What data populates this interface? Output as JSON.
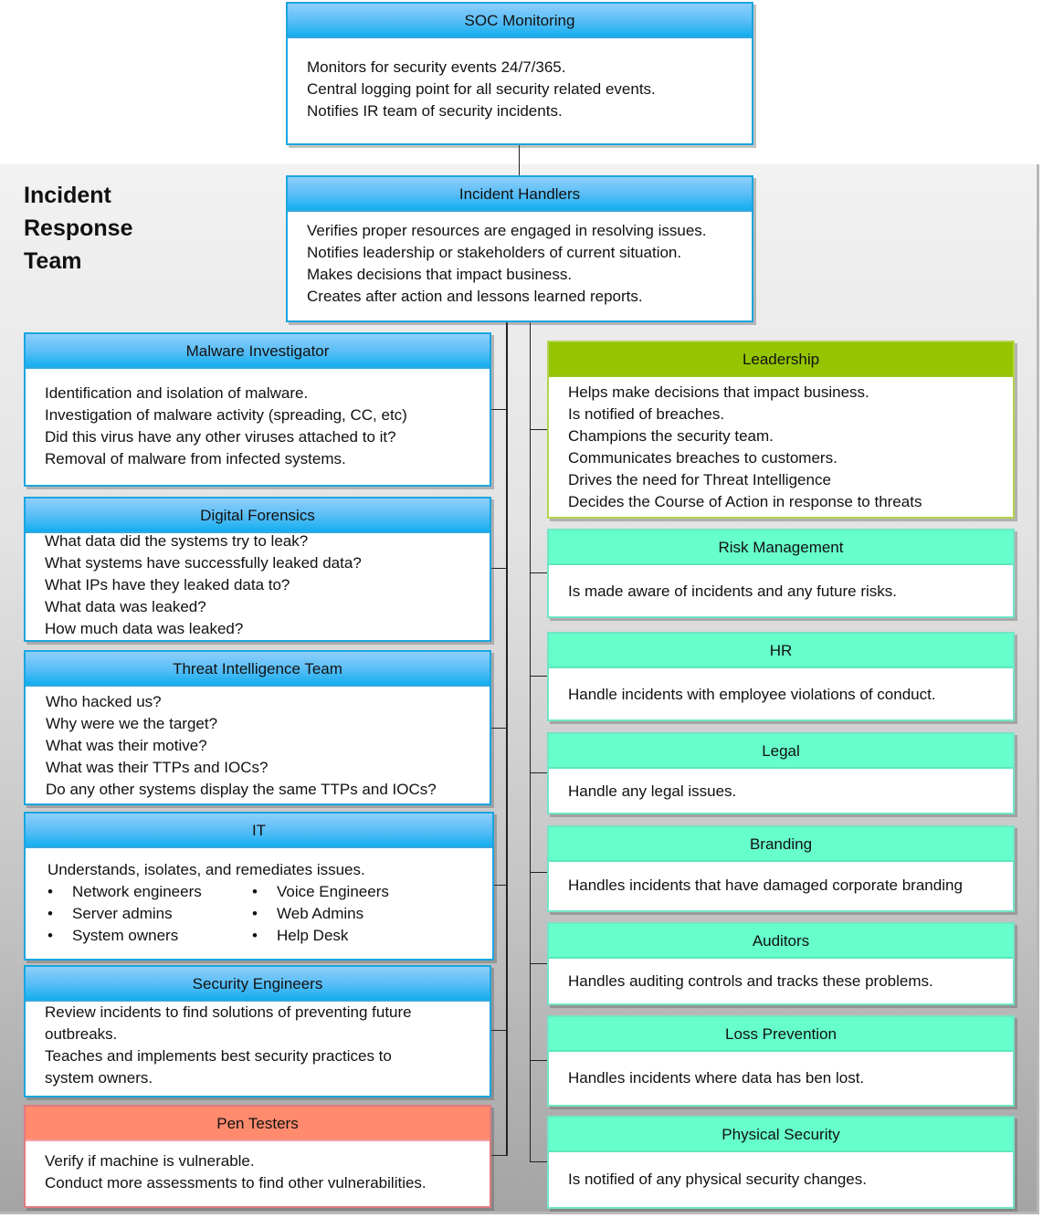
{
  "team_title": [
    "Incident",
    "Response",
    "Team"
  ],
  "colors": {
    "blue_header": "#12aeef",
    "leadership_header": "#94c500",
    "stakeholder_header": "#66ffcc",
    "pen_testers_header": "#ff8a6e"
  },
  "soc": {
    "title": "SOC Monitoring",
    "lines": [
      "Monitors for security events 24/7/365.",
      "Central logging point for all security related events.",
      "Notifies IR team of security incidents."
    ]
  },
  "handlers": {
    "title": "Incident Handlers",
    "lines": [
      "Verifies proper resources are engaged in resolving issues.",
      "Notifies leadership or stakeholders of current situation.",
      "Makes decisions that impact business.",
      "Creates after action and lessons learned reports."
    ]
  },
  "left": {
    "malware": {
      "title": "Malware Investigator",
      "lines": [
        "Identification and isolation of malware.",
        "Investigation of malware activity (spreading, CC, etc)",
        "Did this virus have any other viruses attached to it?",
        "Removal of malware from infected systems."
      ]
    },
    "forensics": {
      "title": "Digital Forensics",
      "lines": [
        "What data did the systems try to leak?",
        "What systems have successfully leaked data?",
        "What IPs have they leaked data to?",
        "What data was leaked?",
        "How much data was leaked?"
      ]
    },
    "threat_intel": {
      "title": "Threat Intelligence Team",
      "lines": [
        "Who hacked us?",
        "Why were we the target?",
        "What was their motive?",
        "What was their TTPs and IOCs?",
        "Do any other systems display the same TTPs and IOCs?"
      ]
    },
    "it": {
      "title": "IT",
      "intro": "Understands, isolates, and remediates issues.",
      "col1": [
        "Network engineers",
        "Server admins",
        "System owners"
      ],
      "col2": [
        "Voice Engineers",
        "Web Admins",
        "Help Desk"
      ]
    },
    "sec_eng": {
      "title": "Security Engineers",
      "lines": [
        "Review incidents to find solutions of preventing future",
        "outbreaks.",
        "Teaches and implements best security practices to",
        "system owners."
      ]
    },
    "pen_testers": {
      "title": "Pen Testers",
      "lines": [
        "Verify if machine is vulnerable.",
        "Conduct more assessments to find other vulnerabilities."
      ]
    }
  },
  "right": {
    "leadership": {
      "title": "Leadership",
      "lines": [
        "Helps make decisions that impact business.",
        "Is notified of breaches.",
        "Champions the security team.",
        "Communicates breaches to customers.",
        "Drives the need for Threat Intelligence",
        "Decides the Course of Action in response to threats"
      ]
    },
    "risk": {
      "title": "Risk Management",
      "text": "Is made aware of incidents and any future risks."
    },
    "hr": {
      "title": "HR",
      "text": "Handle incidents with employee violations of conduct."
    },
    "legal": {
      "title": "Legal",
      "text": "Handle any legal issues."
    },
    "branding": {
      "title": "Branding",
      "text": "Handles incidents that have damaged corporate branding"
    },
    "auditors": {
      "title": "Auditors",
      "text": "Handles auditing controls and tracks these problems."
    },
    "loss_prevention": {
      "title": "Loss Prevention",
      "text": "Handles incidents where data has ben lost."
    },
    "physical_security": {
      "title": "Physical Security",
      "text": "Is notified of any physical security changes."
    }
  }
}
